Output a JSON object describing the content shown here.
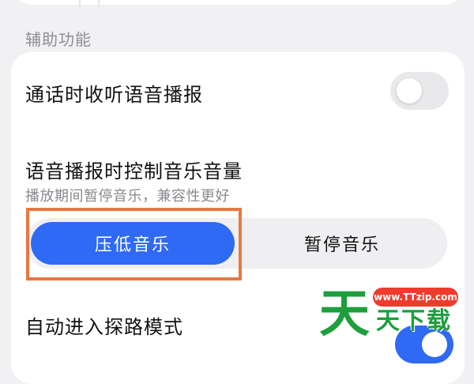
{
  "section": {
    "title": "辅助功能"
  },
  "settings": {
    "call_broadcast": {
      "label": "通话时收听语音播报",
      "enabled": false
    },
    "music_control": {
      "label": "语音播报时控制音乐音量",
      "description": "播放期间暂停音乐，兼容性更好",
      "options": [
        "压低音乐",
        "暂停音乐"
      ],
      "selected": "压低音乐"
    },
    "auto_explore": {
      "label": "自动进入探路模式",
      "enabled": true
    }
  },
  "watermark": {
    "url": "www.TTzip.com",
    "big_char": "天",
    "text": "天下载"
  },
  "colors": {
    "accent": "#2e6af3",
    "highlight": "#e8783f",
    "watermark_green": "#1e9e3c",
    "watermark_red": "#ef3b2d"
  }
}
